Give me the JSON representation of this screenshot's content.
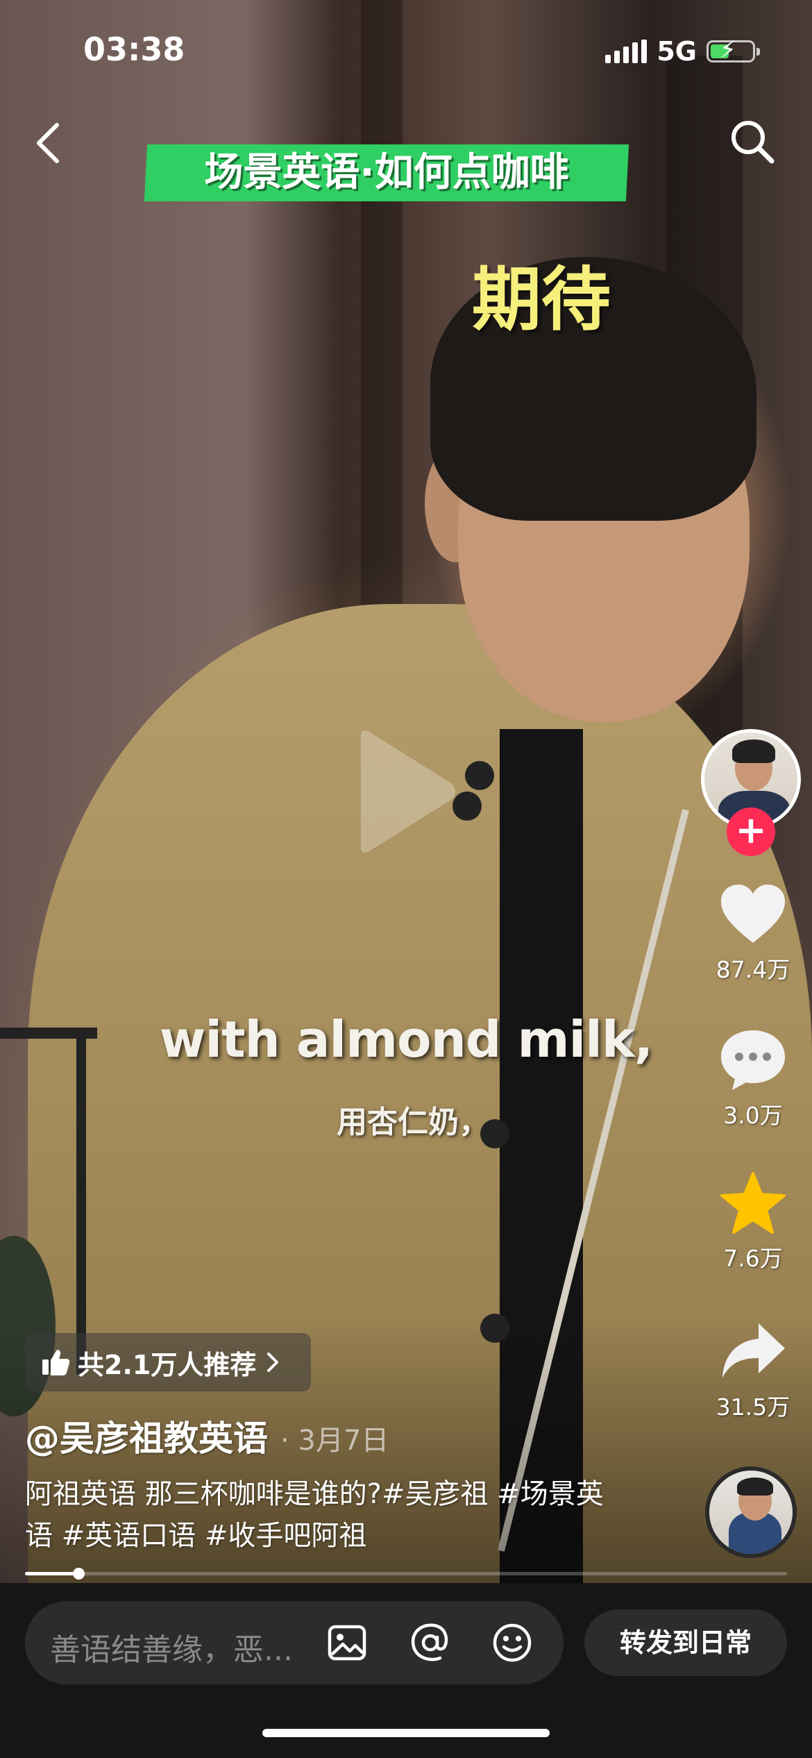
{
  "status_bar": {
    "time": "03:38",
    "network": "5G"
  },
  "overlay": {
    "banner_title": "场景英语·如何点咖啡",
    "keyword": "期待",
    "subtitle_en": "with almond milk,",
    "subtitle_cn": "用杏仁奶，"
  },
  "actions": {
    "likes": "87.4万",
    "comments": "3.0万",
    "favorites": "7.6万",
    "shares": "31.5万"
  },
  "recommend": {
    "text": "共2.1万人推荐"
  },
  "post": {
    "author": "@吴彦祖教英语",
    "date": "· 3月7日",
    "caption": "阿祖英语 那三杯咖啡是谁的?#吴彦祖 #场景英语 #英语口语 #收手吧阿祖"
  },
  "playback": {
    "progress_fraction": 0.07
  },
  "comment_bar": {
    "placeholder": "善语结善缘，恶...",
    "share_daily_label": "转发到日常"
  },
  "colors": {
    "banner": "#2fcf63",
    "keyword": "#f6ef7c",
    "follow": "#fe2c55",
    "star": "#ffc300"
  },
  "icons": [
    "back-chevron-icon",
    "search-icon",
    "play-icon",
    "heart-icon",
    "comment-bubble-icon",
    "star-icon",
    "share-arrow-icon",
    "thumbs-up-icon",
    "chevron-right-icon",
    "image-icon",
    "at-icon",
    "emoji-icon"
  ]
}
